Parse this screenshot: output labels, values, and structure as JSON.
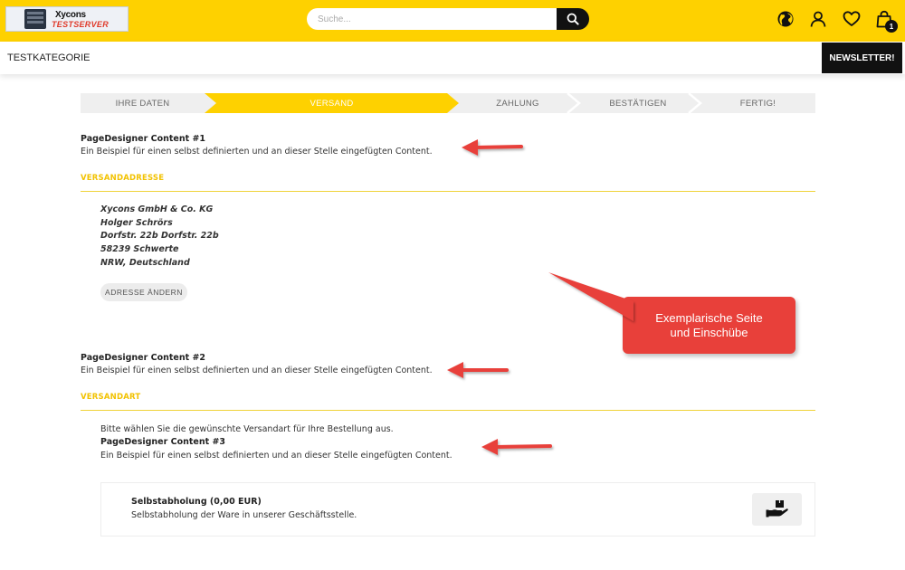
{
  "header": {
    "logo": {
      "name": "Xycons",
      "sub": "TESTSERVER"
    },
    "search": {
      "placeholder": "Suche..."
    },
    "icons": [
      "globe-icon",
      "user-icon",
      "heart-icon",
      "bag-icon"
    ],
    "cart_count": "1"
  },
  "nav": {
    "category": "TESTKATEGORIE",
    "newsletter_label": "NEWSLETTER!"
  },
  "steps": [
    {
      "label": "IHRE DATEN",
      "active": false
    },
    {
      "label": "VERSAND",
      "active": true
    },
    {
      "label": "ZAHLUNG",
      "active": false
    },
    {
      "label": "BESTÄTIGEN",
      "active": false
    },
    {
      "label": "FERTIG!",
      "active": false
    }
  ],
  "content": {
    "pd1": {
      "title": "PageDesigner Content #1",
      "text": "Ein Beispiel für einen selbst definierten und an dieser Stelle eingefügten Content."
    },
    "shipping_address": {
      "title": "VERSANDADRESSE",
      "lines": [
        "Xycons GmbH & Co. KG",
        "Holger Schrörs",
        "Dorfstr. 22b Dorfstr. 22b",
        "58239 Schwerte",
        "NRW, Deutschland"
      ],
      "change_label": "ADRESSE ÄNDERN"
    },
    "pd2": {
      "title": "PageDesigner Content #2",
      "text": "Ein Beispiel für einen selbst definierten und an dieser Stelle eingefügten Content."
    },
    "shipping_method": {
      "title": "VERSANDART",
      "intro": "Bitte wählen Sie die gewünschte Versandart für Ihre Bestellung aus.",
      "pd3": {
        "title": "PageDesigner Content #3",
        "text": "Ein Beispiel für einen selbst definierten und an dieser Stelle eingefügten Content."
      },
      "option": {
        "name": "Selbstabholung (0,00 EUR)",
        "desc": "Selbstabholung der Ware in unserer Geschäftsstelle.",
        "icon": "hand-package-icon"
      }
    }
  },
  "callout": {
    "line1": "Exemplarische Seite",
    "line2": "und Einschübe"
  },
  "colors": {
    "brand": "#fed100",
    "accent_text": "#f2c200",
    "annotation": "#e8403a",
    "dark": "#111111"
  }
}
